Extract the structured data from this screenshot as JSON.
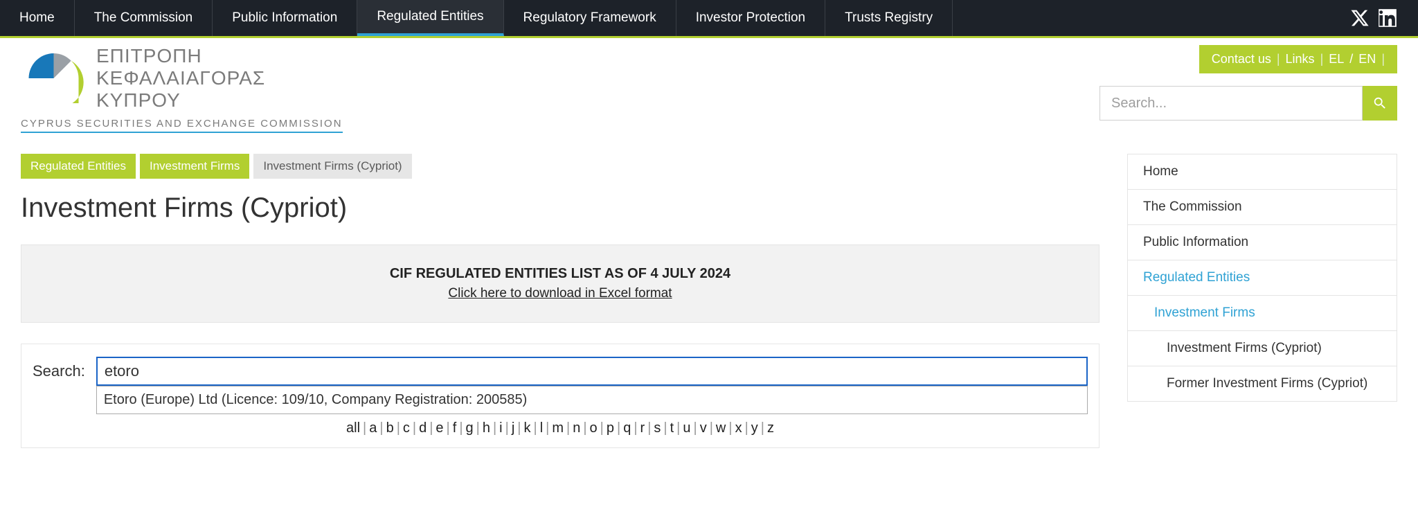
{
  "topnav": {
    "items": [
      {
        "label": "Home"
      },
      {
        "label": "The Commission"
      },
      {
        "label": "Public Information"
      },
      {
        "label": "Regulated Entities",
        "active": true
      },
      {
        "label": "Regulatory Framework"
      },
      {
        "label": "Investor Protection"
      },
      {
        "label": "Trusts Registry"
      }
    ]
  },
  "logo": {
    "greek1": "ΕΠΙΤΡΟΠΗ",
    "greek2": "ΚΕΦΑΛΑΙΑΓΟΡΑΣ",
    "greek3": "ΚΥΠΡΟΥ",
    "sub": "CYPRUS SECURITIES AND EXCHANGE COMMISSION"
  },
  "langbar": {
    "contact": "Contact us",
    "links": "Links",
    "el": "EL",
    "en": "EN"
  },
  "header_search": {
    "placeholder": "Search..."
  },
  "breadcrumb": [
    {
      "label": "Regulated Entities"
    },
    {
      "label": "Investment Firms"
    },
    {
      "label": "Investment Firms (Cypriot)",
      "current": true
    }
  ],
  "page_title": "Investment Firms (Cypriot)",
  "download_box": {
    "line1": "CIF REGULATED ENTITIES LIST AS OF 4 JULY 2024",
    "line2": "Click here to download in Excel format"
  },
  "entity_search": {
    "label": "Search:",
    "value": "etoro",
    "suggestion": "Etoro (Europe) Ltd (Licence: 109/10, Company Registration: 200585)"
  },
  "alpha": [
    "all",
    "a",
    "b",
    "c",
    "d",
    "e",
    "f",
    "g",
    "h",
    "i",
    "j",
    "k",
    "l",
    "m",
    "n",
    "o",
    "p",
    "q",
    "r",
    "s",
    "t",
    "u",
    "v",
    "w",
    "x",
    "y",
    "z"
  ],
  "sidebar": [
    {
      "label": "Home"
    },
    {
      "label": "The Commission"
    },
    {
      "label": "Public Information"
    },
    {
      "label": "Regulated Entities",
      "active": true
    },
    {
      "label": "Investment Firms",
      "active": true,
      "indent": 1
    },
    {
      "label": "Investment Firms (Cypriot)",
      "indent": 2
    },
    {
      "label": "Former Investment Firms (Cypriot)",
      "indent": 2
    }
  ]
}
